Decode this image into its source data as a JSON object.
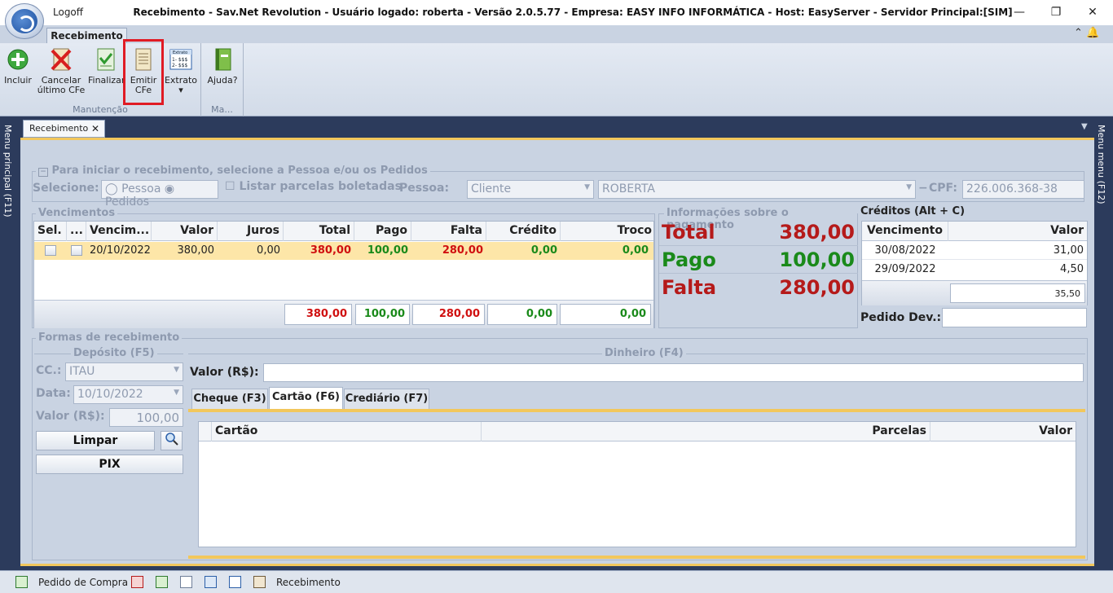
{
  "titlebar": {
    "logoff": "Logoff",
    "title": "Recebimento - Sav.Net Revolution - Usuário logado: roberta - Versão 2.0.5.77 - Empresa: EASY INFO INFORMÁTICA - Host: EasyServer - Servidor Principal:[SIM]",
    "min": "—",
    "max": "❐",
    "close": "✕"
  },
  "ribbon": {
    "tab": "Recebimento",
    "buttons": {
      "incluir": "Incluir",
      "cancelar": "Cancelar último CFe",
      "finalizar": "Finalizar",
      "emitir": "Emitir CFe",
      "extrato": "Extrato",
      "ajuda": "Ajuda?"
    },
    "groups": {
      "manutencao": "Manutenção",
      "ma": "Ma..."
    }
  },
  "side": {
    "left": "Menu principal (F11)",
    "right": "Menu menu (F12)"
  },
  "doctab": {
    "label": "Recebimento",
    "close": "✕"
  },
  "search": {
    "legend": "Para iniciar o recebimento, selecione a Pessoa e/ou os Pedidos",
    "selecione": "Selecione:",
    "pessoa_radio": "Pessoa",
    "pedidos_radio": "Pedidos",
    "listar": "Listar parcelas boletadas",
    "pessoa_label": "Pessoa:",
    "tipo": "Cliente",
    "nome": "ROBERTA",
    "cpf_label": "CPF:",
    "cpf": "226.006.368-38"
  },
  "vencimentos": {
    "legend": "Vencimentos",
    "headers": [
      "Sel.",
      "...",
      "Vencim...",
      "Valor",
      "Juros",
      "Total",
      "Pago",
      "Falta",
      "Crédito",
      "Troco"
    ],
    "rows": [
      {
        "venc": "20/10/2022",
        "valor": "380,00",
        "juros": "0,00",
        "total": "380,00",
        "pago": "100,00",
        "falta": "280,00",
        "credito": "0,00",
        "troco": "0,00"
      }
    ],
    "totals": {
      "total": "380,00",
      "pago": "100,00",
      "falta": "280,00",
      "credito": "0,00",
      "troco": "0,00"
    }
  },
  "info": {
    "legend": "Informações sobre o pagamento",
    "total_label": "Total",
    "total": "380,00",
    "pago_label": "Pago",
    "pago": "100,00",
    "falta_label": "Falta",
    "falta": "280,00"
  },
  "creditos": {
    "title": "Créditos (Alt + C)",
    "headers": [
      "Vencimento",
      "Valor"
    ],
    "rows": [
      {
        "venc": "30/08/2022",
        "valor": "31,00"
      },
      {
        "venc": "29/09/2022",
        "valor": "4,50"
      }
    ],
    "total": "35,50",
    "pedido_dev": "Pedido Dev.:"
  },
  "formas": {
    "legend": "Formas de recebimento",
    "deposito": {
      "legend": "Depósito (F5)",
      "cc_label": "CC.:",
      "cc": "ITAU",
      "data_label": "Data:",
      "data": "10/10/2022",
      "valor_label": "Valor (R$):",
      "valor": "100,00",
      "limpar": "Limpar",
      "pix": "PIX"
    },
    "dinheiro": {
      "legend": "Dinheiro (F4)",
      "valor_label": "Valor (R$):"
    },
    "tabs": [
      "Cheque (F3)",
      "Cartão (F6)",
      "Crediário (F7)"
    ],
    "cartao_headers": [
      "Cartão",
      "Parcelas",
      "Valor"
    ]
  },
  "statusbar": {
    "pedido": "Pedido de Compra",
    "recebimento": "Recebimento"
  },
  "colors": {
    "accent": "#f2c75c",
    "red": "#d01010",
    "green": "#1a8a1a",
    "panel": "#c9d3e2",
    "frame": "#2c3b5c"
  }
}
